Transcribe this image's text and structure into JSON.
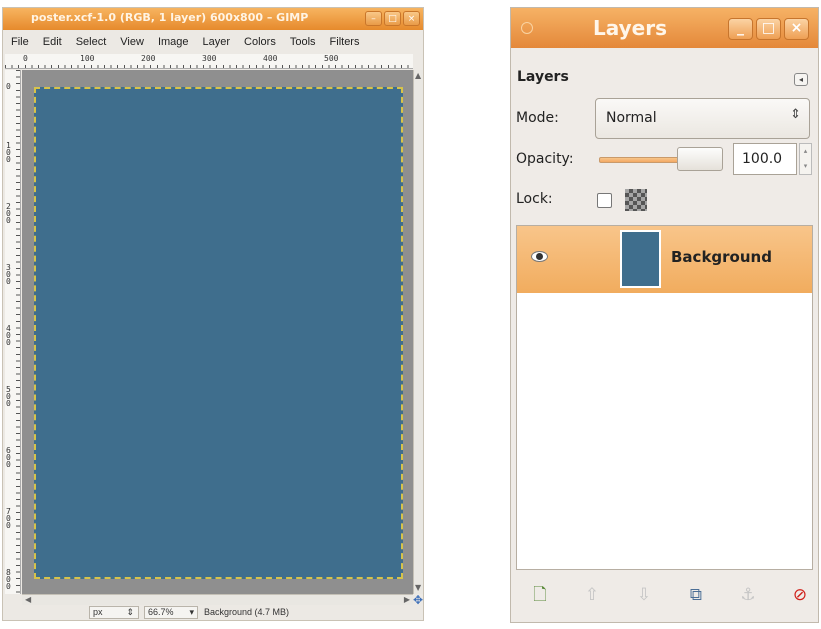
{
  "image_window": {
    "title": "poster.xcf-1.0 (RGB, 1 layer) 600x800 – GIMP",
    "menu": [
      "File",
      "Edit",
      "Select",
      "View",
      "Image",
      "Layer",
      "Colors",
      "Tools",
      "Filters"
    ],
    "ruler_labels": [
      "0",
      "100",
      "200",
      "300",
      "400",
      "500"
    ],
    "vruler_labels": [
      "0",
      "100",
      "200",
      "300",
      "400",
      "500",
      "600",
      "700",
      "800"
    ],
    "canvas_color": "#3f6e8d",
    "status": {
      "unit": "px",
      "zoom": "66.7%",
      "message": "Background (4.7 MB)"
    }
  },
  "layers_dialog": {
    "title": "Layers",
    "heading": "Layers",
    "mode_label": "Mode:",
    "mode_value": "Normal",
    "opacity_label": "Opacity:",
    "opacity_value": "100.0",
    "opacity_level": 1.0,
    "lock_label": "Lock:",
    "layers": [
      {
        "name": "Background",
        "visible": true,
        "selected": true,
        "thumb_color": "#3f6e8d"
      }
    ],
    "toolbar_icons": [
      "new-layer-icon",
      "raise-layer-icon",
      "lower-layer-icon",
      "duplicate-layer-icon",
      "anchor-layer-icon",
      "delete-layer-icon"
    ]
  },
  "accent_color": "#ef9a45"
}
